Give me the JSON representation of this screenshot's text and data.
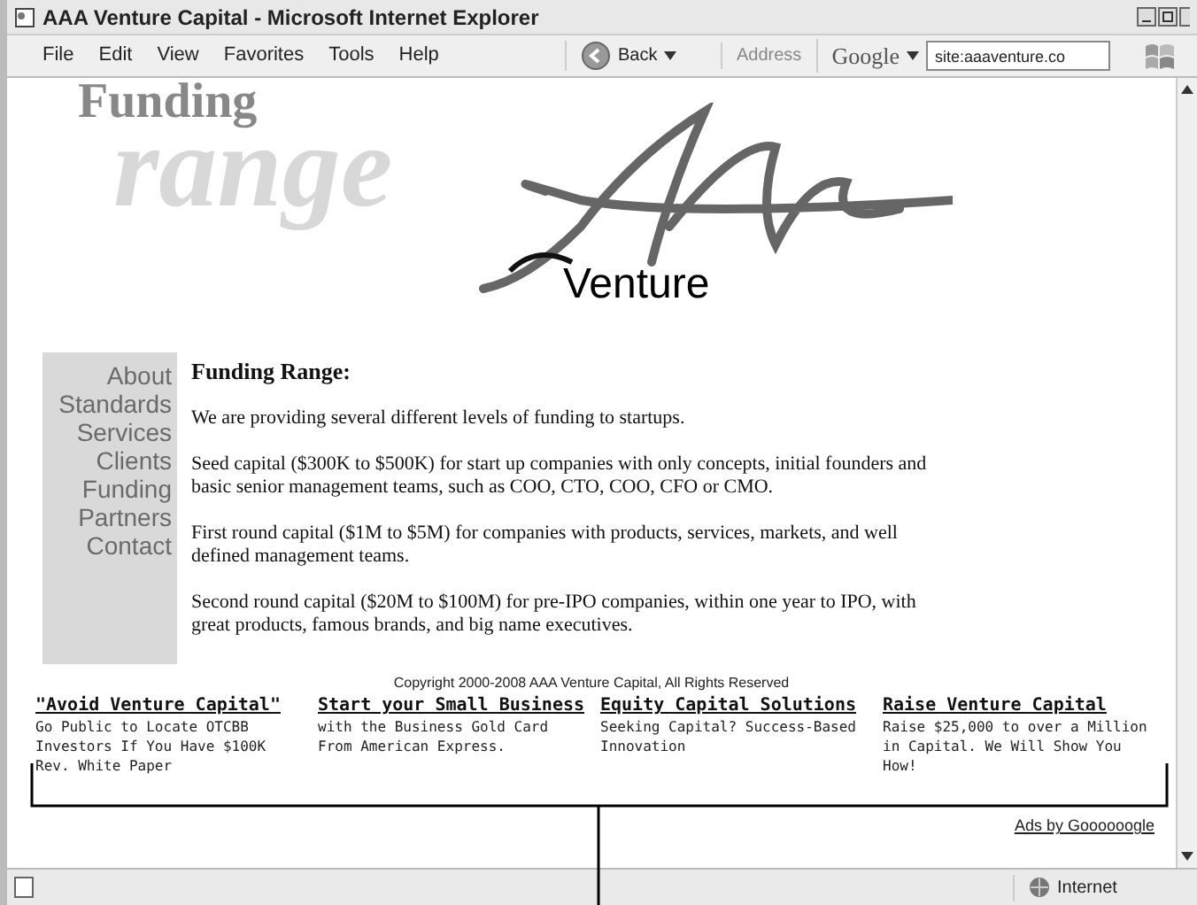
{
  "window": {
    "title": "AAA Venture Capital - Microsoft Internet Explorer"
  },
  "menu": [
    "File",
    "Edit",
    "View",
    "Favorites",
    "Tools",
    "Help"
  ],
  "toolbar": {
    "back": "Back",
    "address_label": "Address",
    "search_brand": "Google",
    "search_value": "site:aaaventure.co"
  },
  "logo": {
    "line_1": "Funding",
    "line_2": "range",
    "brand": "Venture"
  },
  "sidebar": {
    "items": [
      "About",
      "Standards",
      "Services",
      "Clients",
      "Funding",
      "Partners",
      "Contact"
    ]
  },
  "content": {
    "heading": "Funding Range:",
    "paragraphs": [
      "We are providing several different levels of funding to startups.",
      "Seed capital ($300K to $500K) for start up companies with only concepts, initial founders and basic senior management teams, such as COO, CTO, COO, CFO or CMO.",
      "First round capital ($1M to $5M) for companies with products, services, markets, and well defined management teams.",
      "Second round capital ($20M to $100M) for pre-IPO companies, within one year to IPO, with great products, famous brands, and big name executives."
    ]
  },
  "copyright": "Copyright 2000-2008 AAA Venture Capital, All Rights Reserved",
  "ads": [
    {
      "title": "\"Avoid Venture Capital\"",
      "text": "Go Public to Locate OTCBB Investors If You Have $100K Rev. White Paper"
    },
    {
      "title": "Start your Small Business",
      "text": "with the Business Gold Card From American Express."
    },
    {
      "title": "Equity Capital Solutions",
      "text": "Seeking Capital? Success-Based Innovation"
    },
    {
      "title": "Raise Venture Capital",
      "text": "Raise $25,000 to over a Million in Capital. We Will Show You How!"
    }
  ],
  "ads_by": "Ads by Goooooogle",
  "status_bar": {
    "zone": "Internet"
  }
}
